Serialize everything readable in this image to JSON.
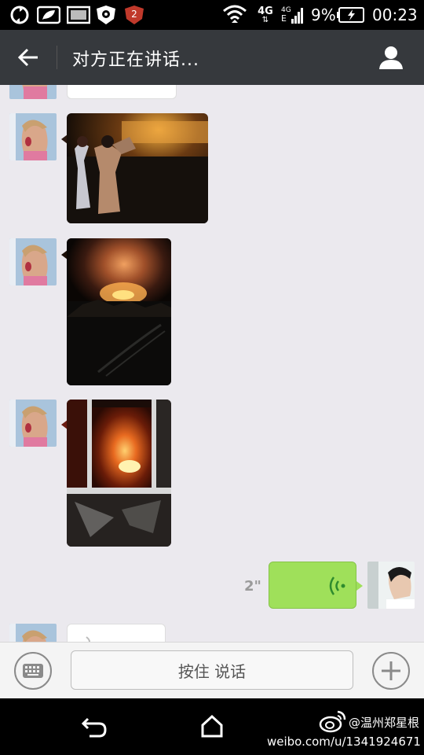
{
  "status_bar": {
    "battery_percent": "9%",
    "time": "00:23",
    "network_4g": "4G",
    "network_4g_small": "4G",
    "network_e": "E",
    "notification_badge": "2"
  },
  "header": {
    "title": "对方正在讲话...",
    "icons": {
      "back": "arrow-left-icon",
      "contact": "person-icon"
    }
  },
  "messages": [
    {
      "type": "image",
      "side": "left",
      "description_icon": "photo",
      "partial": true
    },
    {
      "type": "image",
      "side": "left",
      "scene": "night-street-people"
    },
    {
      "type": "image",
      "side": "left",
      "scene": "explosion-fireball"
    },
    {
      "type": "image",
      "side": "left",
      "scene": "fire-through-broken-window"
    },
    {
      "type": "voice",
      "side": "right",
      "duration": "2\""
    },
    {
      "type": "voice",
      "side": "left",
      "partial": true
    }
  ],
  "input_bar": {
    "talk_label": "按住 说话",
    "icons": {
      "keyboard": "keyboard-icon",
      "more": "plus-icon"
    }
  },
  "nav_bar": {
    "icons": {
      "back": "back-icon",
      "home": "home-icon"
    }
  },
  "watermark": {
    "handle": "@温州郑星根",
    "url": "weibo.com/u/1341924671",
    "icon": "weibo-logo-icon"
  },
  "colors": {
    "titlebar": "#36393d",
    "chat_bg": "#ebe9ee",
    "voice_bubble": "#9fe05a",
    "voice_wave": "#2e8b2e"
  }
}
